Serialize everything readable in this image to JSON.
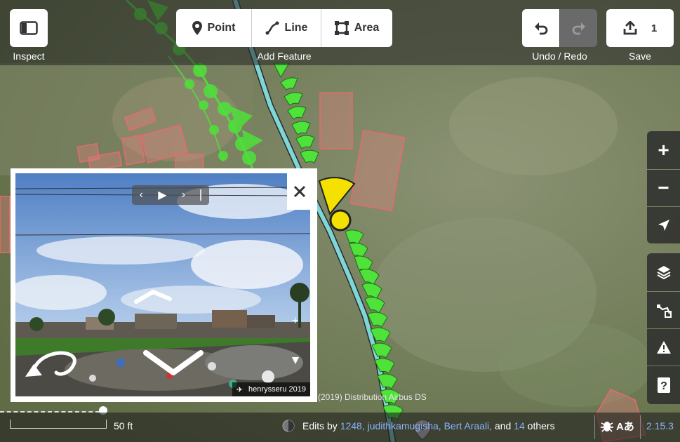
{
  "toolbar": {
    "inspect_label": "Inspect",
    "add_feature_label": "Add Feature",
    "point_label": "Point",
    "line_label": "Line",
    "area_label": "Area",
    "undo_redo_label": "Undo / Redo",
    "save_label": "Save",
    "save_count": "1"
  },
  "map_controls": {
    "zoom_in": "+",
    "zoom_out": "−"
  },
  "photo_viewer": {
    "credit": "henrysseru 2019"
  },
  "map": {
    "attribution": "(2019) Distribution Airbus DS"
  },
  "footer": {
    "scale_label": "50 ft",
    "edits_prefix": "Edits by",
    "editors_list": "1248, judithkamugisha, Bert Araali,",
    "and_text": "and",
    "others_count": "14",
    "others_text": "others",
    "version": "2.15.3"
  },
  "colors": {
    "path_green": "#4ee23a",
    "selected_yellow": "#f5e100",
    "road_cyan": "#7fd6d6",
    "building_outline": "#e86a6a",
    "link_blue": "#8ab4f8"
  }
}
